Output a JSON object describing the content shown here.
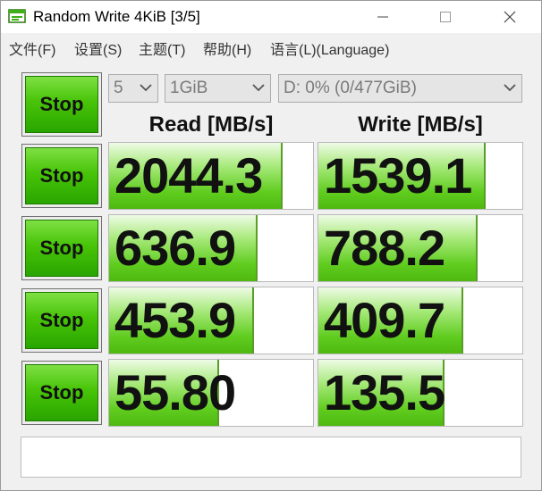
{
  "window": {
    "title": "Random Write 4KiB [3/5]"
  },
  "menu": [
    {
      "label": "文件(F)"
    },
    {
      "label": "设置(S)"
    },
    {
      "label": "主题(T)"
    },
    {
      "label": "帮助(H)"
    },
    {
      "label": "语言(L)(Language)"
    }
  ],
  "controls": {
    "stop_label": "Stop",
    "count": "5",
    "size": "1GiB",
    "drive": "D: 0% (0/477GiB)"
  },
  "headers": {
    "read": "Read [MB/s]",
    "write": "Write [MB/s]"
  },
  "results": [
    {
      "read": "2044.3",
      "read_fill": 0.84,
      "write": "1539.1",
      "write_fill": 0.81
    },
    {
      "read": "636.9",
      "read_fill": 0.72,
      "write": "788.2",
      "write_fill": 0.77
    },
    {
      "read": "453.9",
      "read_fill": 0.7,
      "write": "409.7",
      "write_fill": 0.7
    },
    {
      "read": "55.80",
      "read_fill": 0.53,
      "write": "135.5",
      "write_fill": 0.61
    }
  ],
  "comment": ""
}
